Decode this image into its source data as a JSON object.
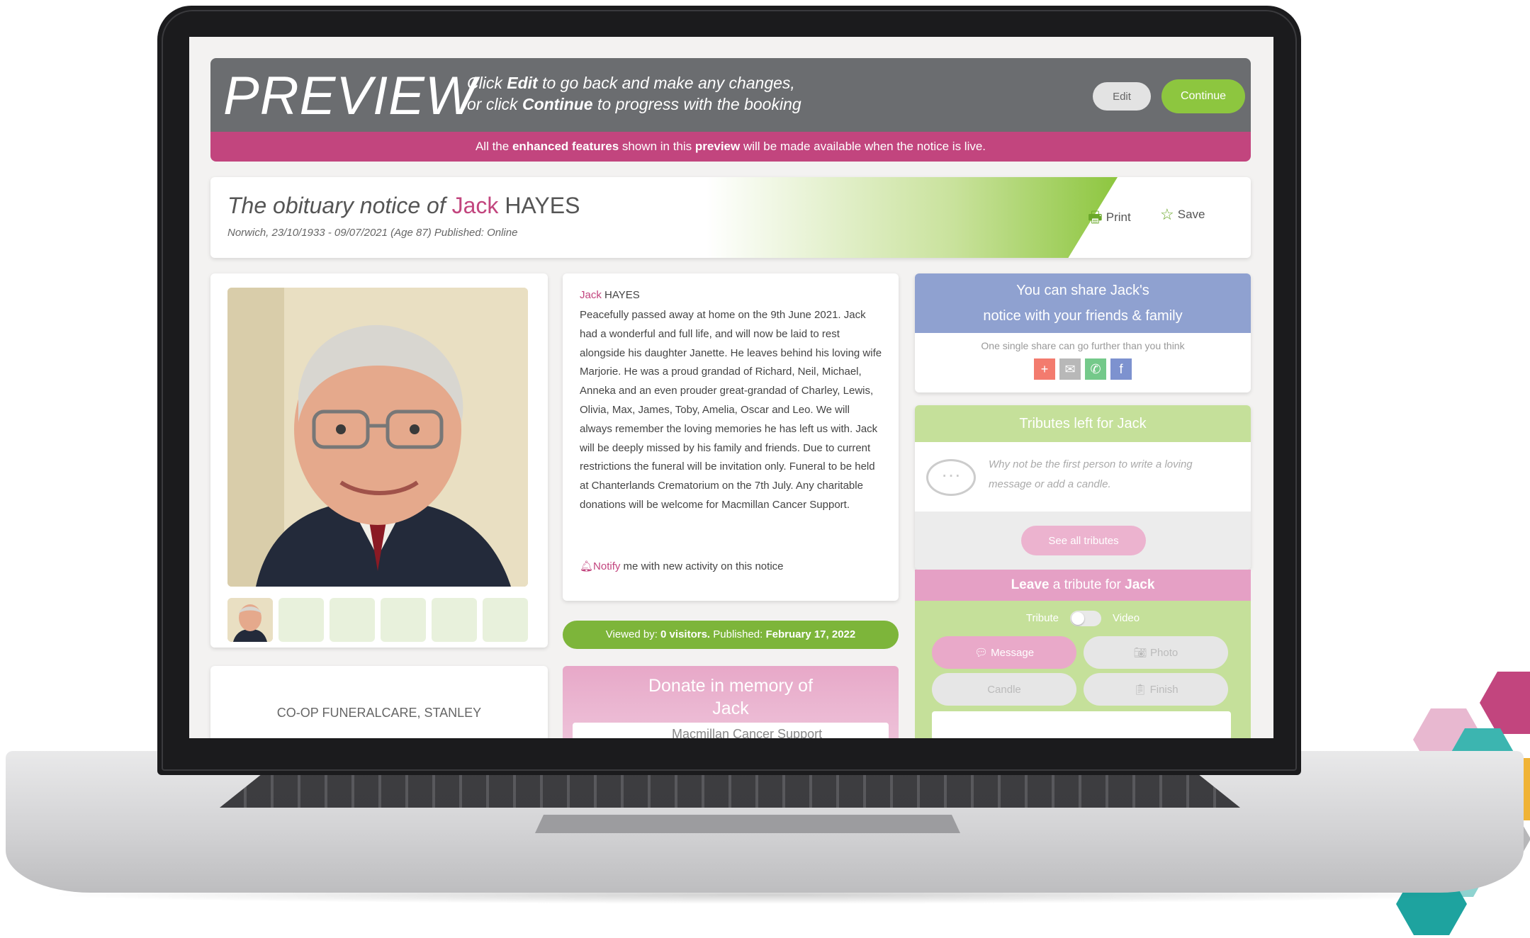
{
  "preview": {
    "word": "PREVIEW",
    "hint_line1_pre": "Click ",
    "hint_line1_bold": "Edit",
    "hint_line1_post": " to go back and make any changes,",
    "hint_line2_pre": "or click ",
    "hint_line2_bold": "Continue",
    "hint_line2_post": " to progress with the booking",
    "edit_label": "Edit",
    "continue_label": "Continue"
  },
  "enhanced": {
    "pre": "All the ",
    "bold1": "enhanced features",
    "mid": " shown in this ",
    "bold2": "preview",
    "post": " will be made available when the notice is live."
  },
  "title": {
    "lead": "The obituary notice of ",
    "first_name": "Jack",
    "surname": "HAYES",
    "subtitle": "Norwich, 23/10/1933 - 09/07/2021 (Age 87) Published: Online",
    "print_label": "Print",
    "save_label": "Save"
  },
  "notice": {
    "first_name": "Jack",
    "surname": "HAYES",
    "body": "Peacefully passed away at home on the 9th June 2021. Jack had a wonderful and full life, and will now be laid to rest alongside his daughter Janette. He leaves behind his loving wife Marjorie. He was a proud grandad of Richard, Neil, Michael, Anneka and an even prouder great-grandad of Charley, Lewis, Olivia, Max, James, Toby, Amelia, Oscar and Leo. We will always remember the loving memories he has left us with. Jack will be deeply missed by his family and friends. Due to current restrictions the funeral will be invitation only. Funeral to be held at Chanterlands Crematorium on the 7th July. Any charitable donations will be welcome for Macmillan Cancer Support.",
    "notify_link": "Notify",
    "notify_rest": " me with new activity on this notice"
  },
  "viewed": {
    "pre": "Viewed by: ",
    "count": "0 visitors.",
    "mid": " Published: ",
    "date": "February 17, 2022"
  },
  "donate": {
    "title_line1": "Donate in memory of",
    "title_line2": "Jack",
    "charity": "Macmillan Cancer Support"
  },
  "funeral_director": "CO-OP FUNERALCARE, STANLEY",
  "share": {
    "title_line1": "You can share Jack's",
    "title_line2": "notice with your friends & family",
    "subtitle": "One single share can go further than you think",
    "icons": [
      "+",
      "✉",
      "✆",
      "f"
    ]
  },
  "tributes": {
    "title": "Tributes left for Jack",
    "empty_text": "Why not be the first person to write a loving message or add a candle.",
    "see_all_label": "See all tributes"
  },
  "leave": {
    "title_pre": "Leave",
    "title_mid": " a tribute for ",
    "title_name": "Jack",
    "toggle_left": "Tribute",
    "toggle_right": "Video",
    "message_label": "Message",
    "photo_label": "Photo",
    "candle_label": "Candle",
    "finish_label": "Finish"
  },
  "colors": {
    "brand_pink": "#c2457e",
    "brand_green": "#8dc63f",
    "banner_grey": "#6b6d70",
    "share_blue": "#8fa1d0"
  }
}
